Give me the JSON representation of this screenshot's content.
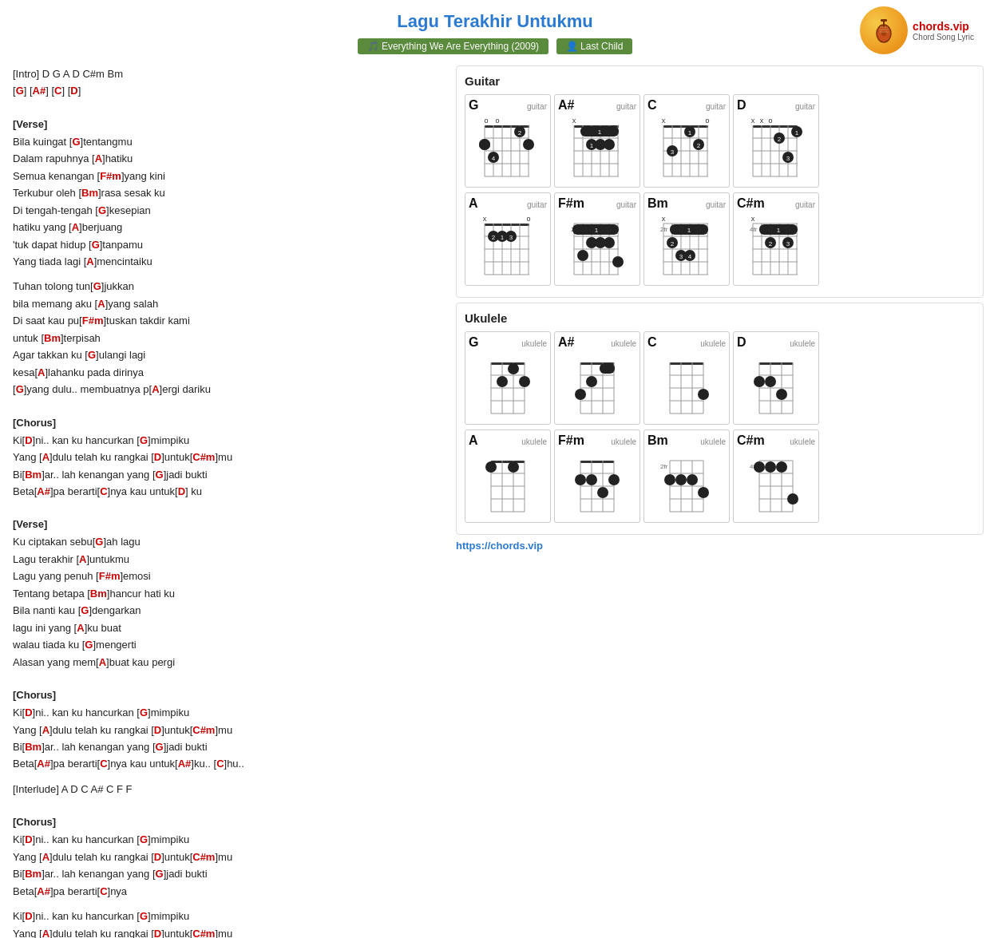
{
  "header": {
    "title": "Lagu Terakhir Untukmu",
    "badge_album": "🎵 Everything We Are Everything (2009)",
    "badge_artist": "👤 Last Child",
    "website": "https://chords.vip",
    "logo_alt": "chords.vip"
  },
  "lyrics": {
    "intro": "[Intro] D G A D C#m Bm",
    "intro_chords": "[G] [A#] [C] [D]",
    "sections": []
  },
  "guitar_section_title": "Guitar",
  "ukulele_section_title": "Ukulele",
  "guitar_chords": [
    "G",
    "A#",
    "C",
    "D",
    "A",
    "F#m",
    "Bm",
    "C#m"
  ],
  "ukulele_chords": [
    "G",
    "A#",
    "C",
    "D",
    "A",
    "F#m",
    "Bm",
    "C#m"
  ]
}
